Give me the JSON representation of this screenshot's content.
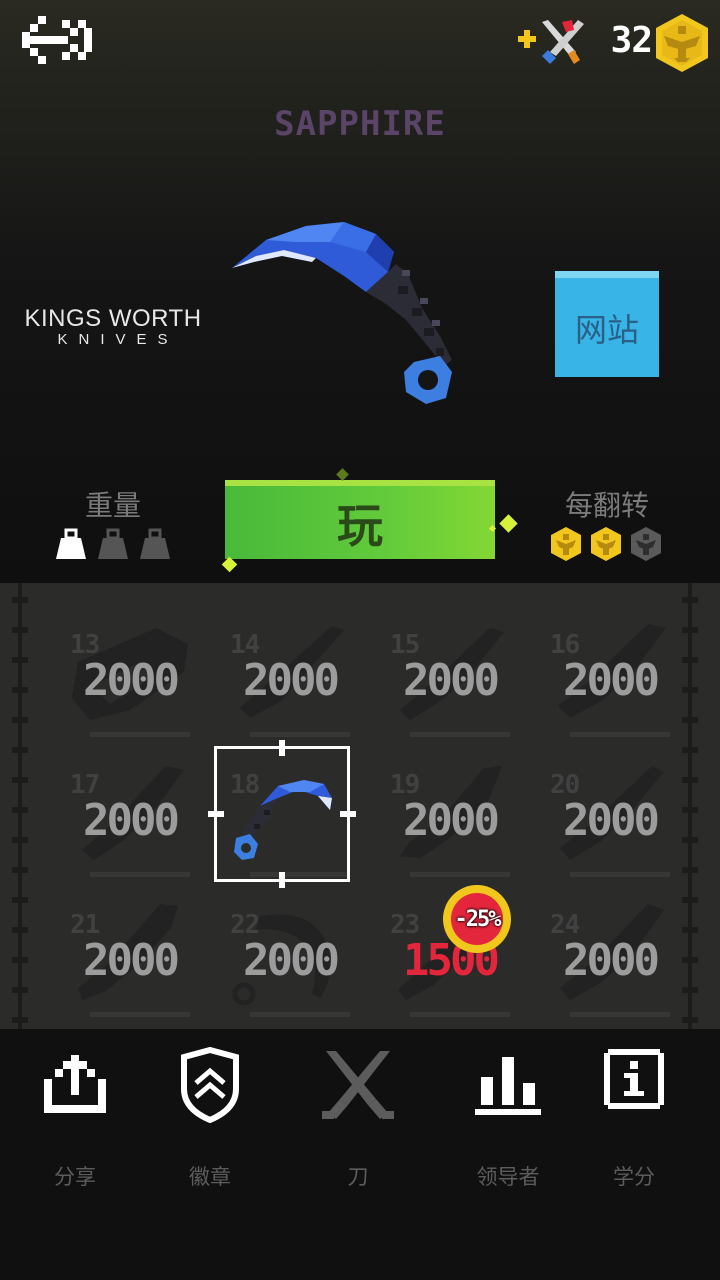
{
  "header": {
    "back_icon": "back-arrow-icon",
    "add_knife_icon": "crossed-knives-plus-icon",
    "coin_count": "32",
    "coin_icon": "gold-hexagon-coin-icon"
  },
  "knife": {
    "name": "SAPPHIRE",
    "brand_line1": "KINGS WORTH",
    "brand_line2": "KNIVES",
    "website_label": "网站",
    "weight_label": "重量",
    "weight_level": 1,
    "weight_max": 3,
    "per_flip_label": "每翻转",
    "per_flip_coins": 2,
    "per_flip_max": 3
  },
  "play_label": "玩",
  "knife_grid": [
    {
      "num": "13",
      "price": "2000",
      "sale": false
    },
    {
      "num": "14",
      "price": "2000",
      "sale": false
    },
    {
      "num": "15",
      "price": "2000",
      "sale": false
    },
    {
      "num": "16",
      "price": "2000",
      "sale": false
    },
    {
      "num": "17",
      "price": "2000",
      "sale": false
    },
    {
      "num": "18",
      "price": "",
      "sale": false,
      "selected": true,
      "owned": true
    },
    {
      "num": "19",
      "price": "2000",
      "sale": false
    },
    {
      "num": "20",
      "price": "2000",
      "sale": false
    },
    {
      "num": "21",
      "price": "2000",
      "sale": false
    },
    {
      "num": "22",
      "price": "2000",
      "sale": false
    },
    {
      "num": "23",
      "price": "1500",
      "sale": true,
      "discount": "-25%"
    },
    {
      "num": "24",
      "price": "2000",
      "sale": false
    }
  ],
  "nav": [
    {
      "label": "分享",
      "icon": "share-icon"
    },
    {
      "label": "徽章",
      "icon": "badge-shield-icon"
    },
    {
      "label": "刀",
      "icon": "crossed-knives-icon"
    },
    {
      "label": "领导者",
      "icon": "leaderboard-icon"
    },
    {
      "label": "学分",
      "icon": "info-icon"
    }
  ],
  "colors": {
    "accent_green": "#63cb3b",
    "website_blue": "#38b4e6",
    "coin_gold": "#f2c71d",
    "sale_red": "#e3263c",
    "knife_blue": "#3e6fe0"
  }
}
